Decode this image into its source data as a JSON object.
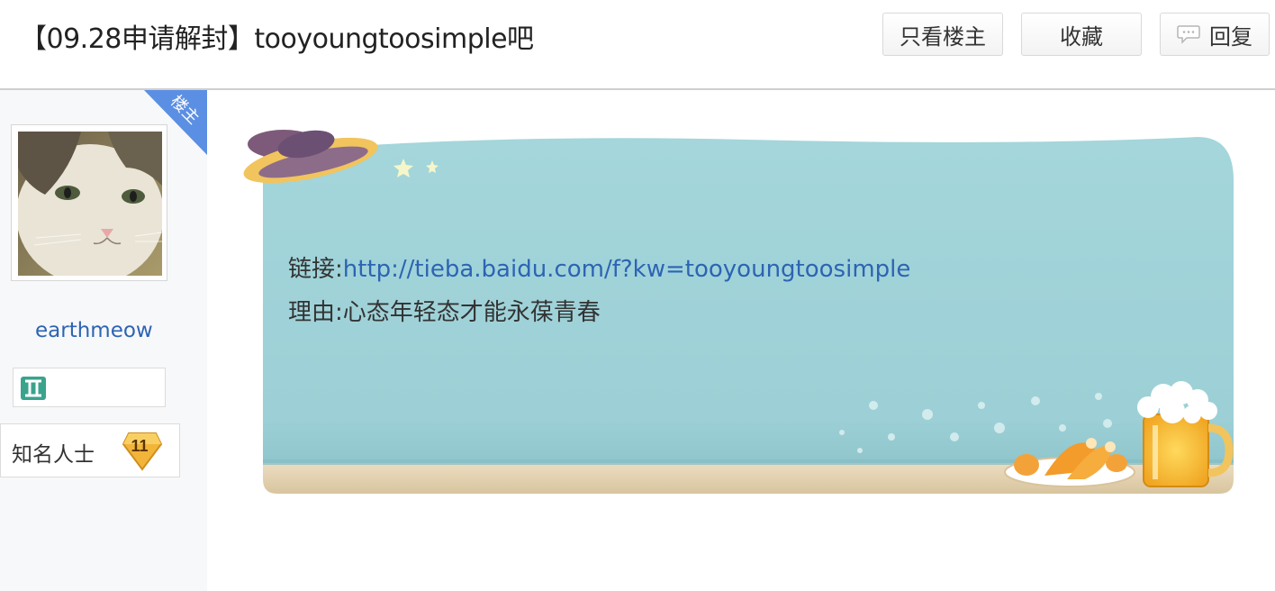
{
  "header": {
    "title": "【09.28申请解封】tooyoungtoosimple吧",
    "btn_only_owner": "只看楼主",
    "btn_favorite": "收藏",
    "btn_reply": "回复"
  },
  "author": {
    "badge": "楼主",
    "username": "earthmeow",
    "zodiac_icon": "gemini-icon",
    "level_label": "知名人士",
    "level_number": "11"
  },
  "post": {
    "link_label": "链接:",
    "link_url": "http://tieba.baidu.com/f?kw=tooyoungtoosimple",
    "reason_label": "理由:",
    "reason_text": "心态年轻态才能永葆青春"
  },
  "colors": {
    "bubble": "#9fd3d8",
    "link": "#2d64b3",
    "badge": "#5b8fe3"
  }
}
